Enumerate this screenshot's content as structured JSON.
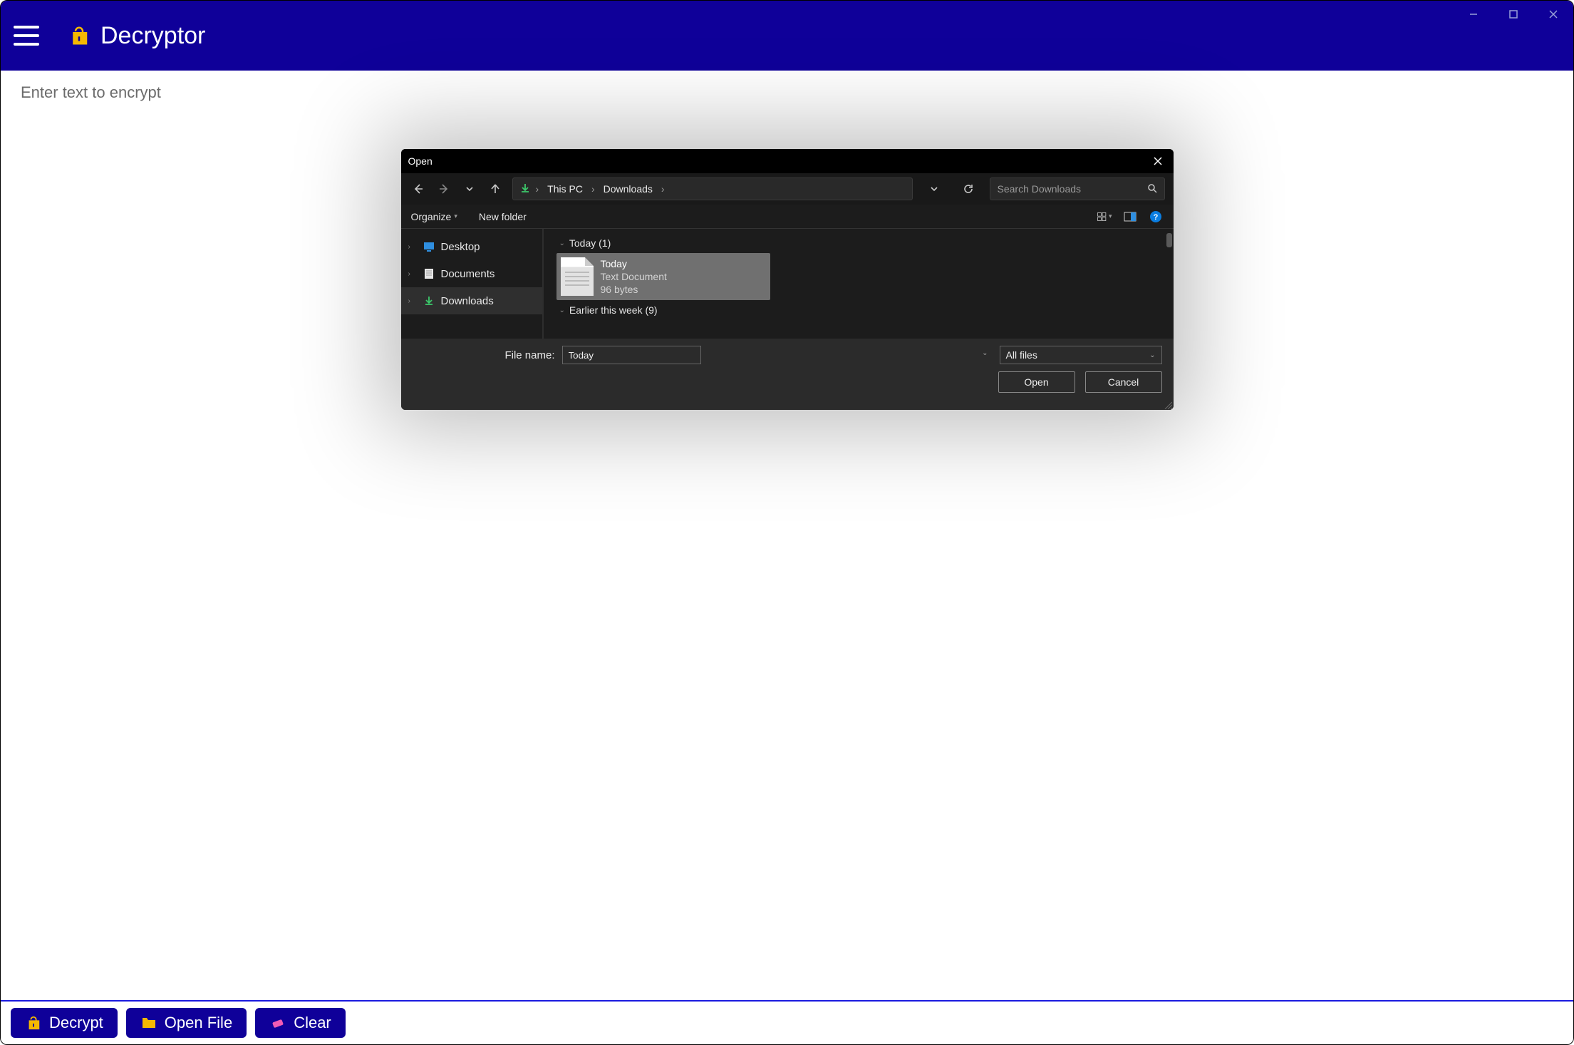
{
  "app": {
    "title": "Decryptor",
    "placeholder": "Enter text to encrypt"
  },
  "bottom": {
    "decrypt": "Decrypt",
    "open_file": "Open File",
    "clear": "Clear"
  },
  "dialog": {
    "title": "Open",
    "breadcrumbs": [
      "This PC",
      "Downloads"
    ],
    "search_placeholder": "Search Downloads",
    "organize": "Organize",
    "new_folder": "New folder",
    "tree": [
      {
        "label": "Desktop",
        "selected": false
      },
      {
        "label": "Documents",
        "selected": false
      },
      {
        "label": "Downloads",
        "selected": true
      }
    ],
    "groups": [
      {
        "header": "Today (1)"
      },
      {
        "header": "Earlier this week (9)"
      }
    ],
    "selected_file": {
      "name": "Today",
      "type": "Text Document",
      "size": "96 bytes"
    },
    "filename_label": "File name:",
    "filename_value": "Today",
    "filetype": "All files",
    "open_btn": "Open",
    "cancel_btn": "Cancel"
  }
}
